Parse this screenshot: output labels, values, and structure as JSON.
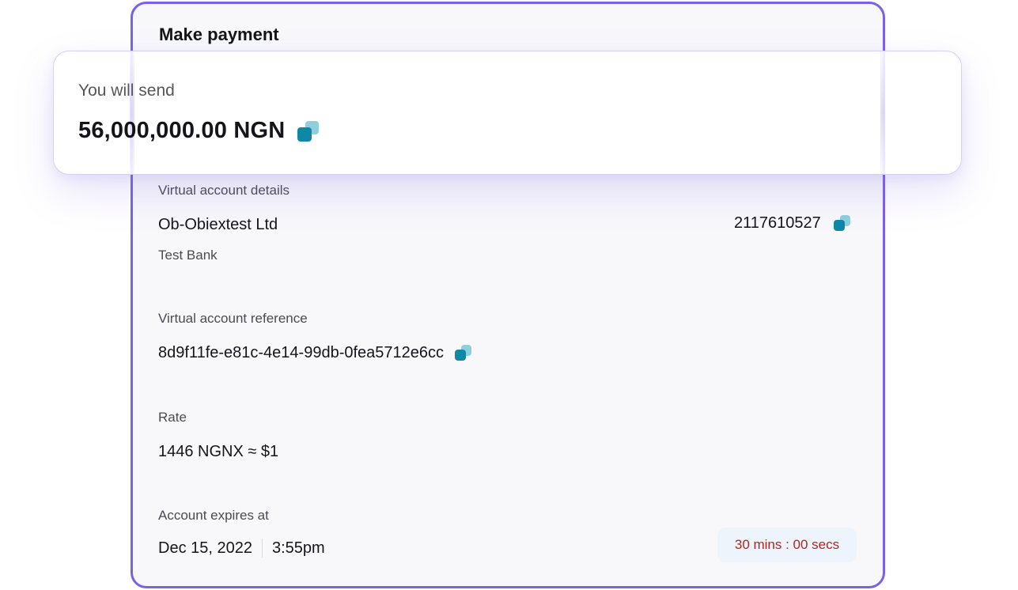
{
  "panel": {
    "title": "Make payment"
  },
  "send_card": {
    "label": "You will send",
    "amount": "56,000,000.00 NGN",
    "copy_icon": "copy-icon"
  },
  "virtual_account": {
    "label": "Virtual account details",
    "account_name": "Ob-Obiextest Ltd",
    "account_number": "2117610527",
    "bank_name": "Test Bank"
  },
  "reference": {
    "label": "Virtual account reference",
    "value": "8d9f11fe-e81c-4e14-99db-0fea5712e6cc"
  },
  "rate": {
    "label": "Rate",
    "value": "1446 NGNX ≈ $1"
  },
  "expiry": {
    "label": "Account expires at",
    "date": "Dec 15, 2022",
    "time": "3:55pm",
    "countdown": "30 mins : 00 secs"
  },
  "colors": {
    "accent_border": "#7b61e8",
    "copy_icon_front": "#0f88a6",
    "copy_icon_back": "#8ecfdd",
    "countdown_text": "#b3261e",
    "countdown_bg": "#eef4fb"
  }
}
